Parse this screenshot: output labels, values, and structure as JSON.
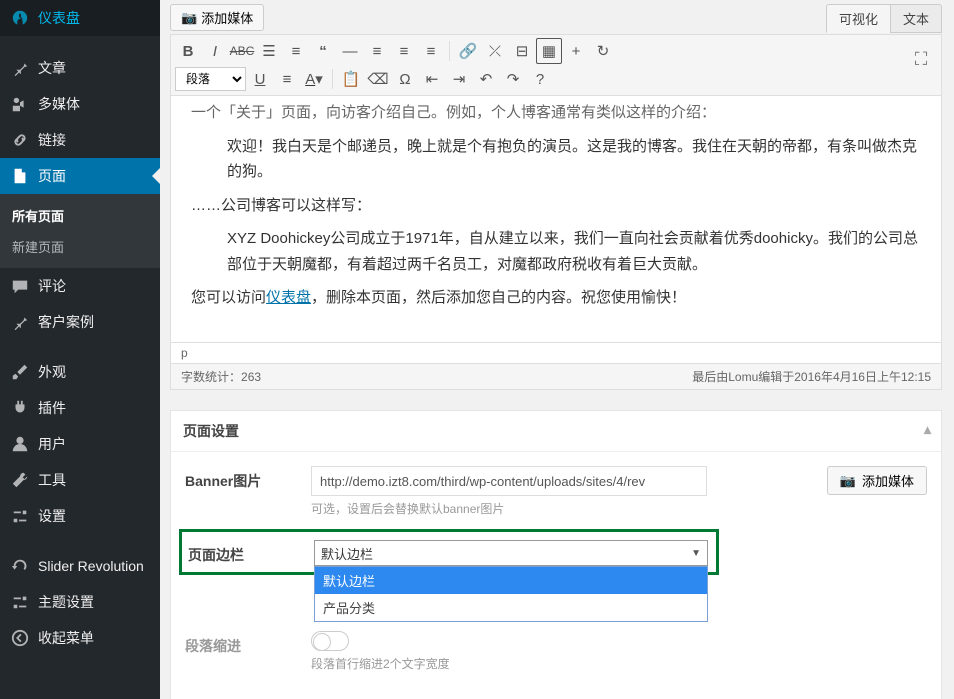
{
  "sidebar": {
    "items": [
      {
        "label": "仪表盘",
        "icon": "dashboard"
      },
      {
        "label": "文章",
        "icon": "pin",
        "sep_before": true
      },
      {
        "label": "多媒体",
        "icon": "media"
      },
      {
        "label": "链接",
        "icon": "link"
      },
      {
        "label": "页面",
        "icon": "page",
        "current": true,
        "submenu": [
          {
            "label": "所有页面",
            "active": true
          },
          {
            "label": "新建页面"
          }
        ]
      },
      {
        "label": "评论",
        "icon": "comment"
      },
      {
        "label": "客户案例",
        "icon": "pin"
      },
      {
        "label": "外观",
        "icon": "brush",
        "sep_before": true
      },
      {
        "label": "插件",
        "icon": "plug"
      },
      {
        "label": "用户",
        "icon": "user"
      },
      {
        "label": "工具",
        "icon": "tool"
      },
      {
        "label": "设置",
        "icon": "settings"
      },
      {
        "label": "Slider Revolution",
        "icon": "refresh",
        "sep_before": true
      },
      {
        "label": "主题设置",
        "icon": "settings"
      },
      {
        "label": "收起菜单",
        "icon": "collapse"
      }
    ]
  },
  "media_button": "添加媒体",
  "tabs": {
    "visual": "可视化",
    "text": "文本"
  },
  "toolbar": {
    "format_label": "段落"
  },
  "editor": {
    "line0": "一个「关于」页面，向访客介绍自己。例如，个人博客通常有类似这样的介绍：",
    "line1": "欢迎！我白天是个邮递员，晚上就是个有抱负的演员。这是我的博客。我住在天朝的帝都，有条叫做杰克的狗。",
    "line2": "……公司博客可以这样写：",
    "line3": "XYZ Doohickey公司成立于1971年，自从建立以来，我们一直向社会贡献着优秀doohicky。我们的公司总部位于天朝魔都，有着超过两千名员工，对魔都政府税收有着巨大贡献。",
    "line4_a": "您可以访问",
    "line4_link": "仪表盘",
    "line4_b": "，删除本页面，然后添加您自己的内容。祝您使用愉快！",
    "path": "p",
    "wordcount_label": "字数统计：",
    "wordcount": "263",
    "lastedit": "最后由Lomu编辑于2016年4月16日上午12:15"
  },
  "page_settings": {
    "title": "页面设置",
    "banner": {
      "label": "Banner图片",
      "value": "http://demo.izt8.com/third/wp-content/uploads/sites/4/rev",
      "desc": "可选，设置后会替换默认banner图片",
      "media_btn": "添加媒体"
    },
    "sidebar_field": {
      "label": "页面边栏",
      "selected": "默认边栏",
      "options": [
        "默认边栏",
        "产品分类"
      ]
    },
    "indent": {
      "label": "段落缩进",
      "desc": "段落首行缩进2个文字宽度"
    }
  }
}
